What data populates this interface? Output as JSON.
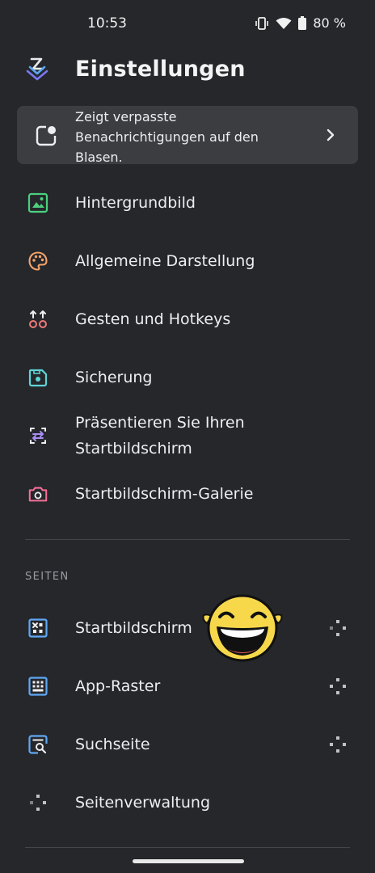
{
  "status_bar": {
    "time": "10:53",
    "battery": "80 %"
  },
  "header": {
    "title": "Einstellungen"
  },
  "banner": {
    "text": "Zeigt verpasste Benachrichtigungen auf den Blasen."
  },
  "menu": [
    {
      "label": "Hintergrundbild",
      "icon": "image-icon",
      "color": "#4cd07d"
    },
    {
      "label": "Allgemeine Darstellung",
      "icon": "palette-icon",
      "color": "#f4a36a"
    },
    {
      "label": "Gesten und Hotkeys",
      "icon": "gestures-icon",
      "color": "#f27a7a"
    },
    {
      "label": "Sicherung",
      "icon": "backup-icon",
      "color": "#5fd3d6"
    },
    {
      "label": "Präsentieren Sie Ihren Startbildschirm",
      "icon": "share-icon",
      "color": "#a98cf5"
    },
    {
      "label": "Startbildschirm-Galerie",
      "icon": "camera-icon",
      "color": "#f36f96"
    }
  ],
  "section": {
    "label": "SEITEN"
  },
  "pages": [
    {
      "label": "Startbildschirm",
      "icon": "home-grid-icon",
      "color": "#5fa8f5"
    },
    {
      "label": "App-Raster",
      "icon": "app-grid-icon",
      "color": "#5fa8f5"
    },
    {
      "label": "Suchseite",
      "icon": "search-page-icon",
      "color": "#5fa8f5"
    }
  ],
  "page_management": {
    "label": "Seitenverwaltung",
    "icon": "drag-cross-icon"
  }
}
